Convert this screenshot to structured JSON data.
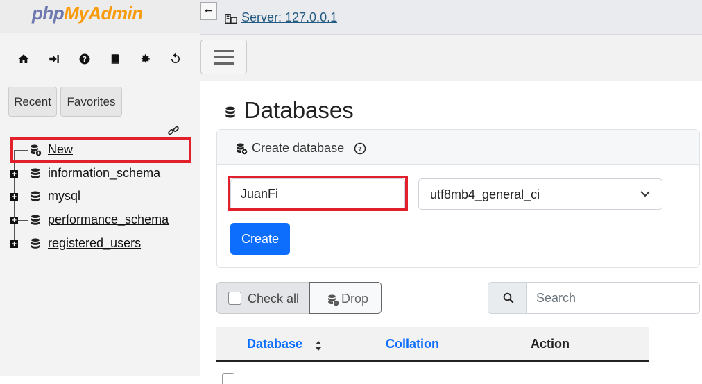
{
  "app": {
    "logo_part1": "php",
    "logo_part2": "MyAdmin",
    "brand_colors": {
      "php": "#6c78af",
      "myadmin": "#f89c0e"
    }
  },
  "nav_icons": [
    "home-icon",
    "logout-icon",
    "help-icon",
    "docs-icon",
    "settings-icon",
    "reload-icon"
  ],
  "nav_tabs": {
    "recent": "Recent",
    "favorites": "Favorites"
  },
  "tree": {
    "new_label": "New",
    "databases": [
      "information_schema",
      "mysql",
      "performance_schema",
      "registered_users"
    ],
    "expander_glyph": "+"
  },
  "topbar": {
    "collapse_glyph": "←",
    "server_label": "Server: 127.0.0.1"
  },
  "main": {
    "title": "Databases",
    "create_section": {
      "heading": "Create database",
      "name_value": "JuanFi",
      "collation_value": "utf8mb4_general_ci",
      "create_button": "Create"
    },
    "toolbar": {
      "check_all": "Check all",
      "drop": "Drop",
      "search_placeholder": "Search"
    },
    "table": {
      "columns": [
        "Database",
        "Collation",
        "Action"
      ]
    }
  },
  "highlight_color": "#e2202c",
  "accent_color": "#0d6efd"
}
